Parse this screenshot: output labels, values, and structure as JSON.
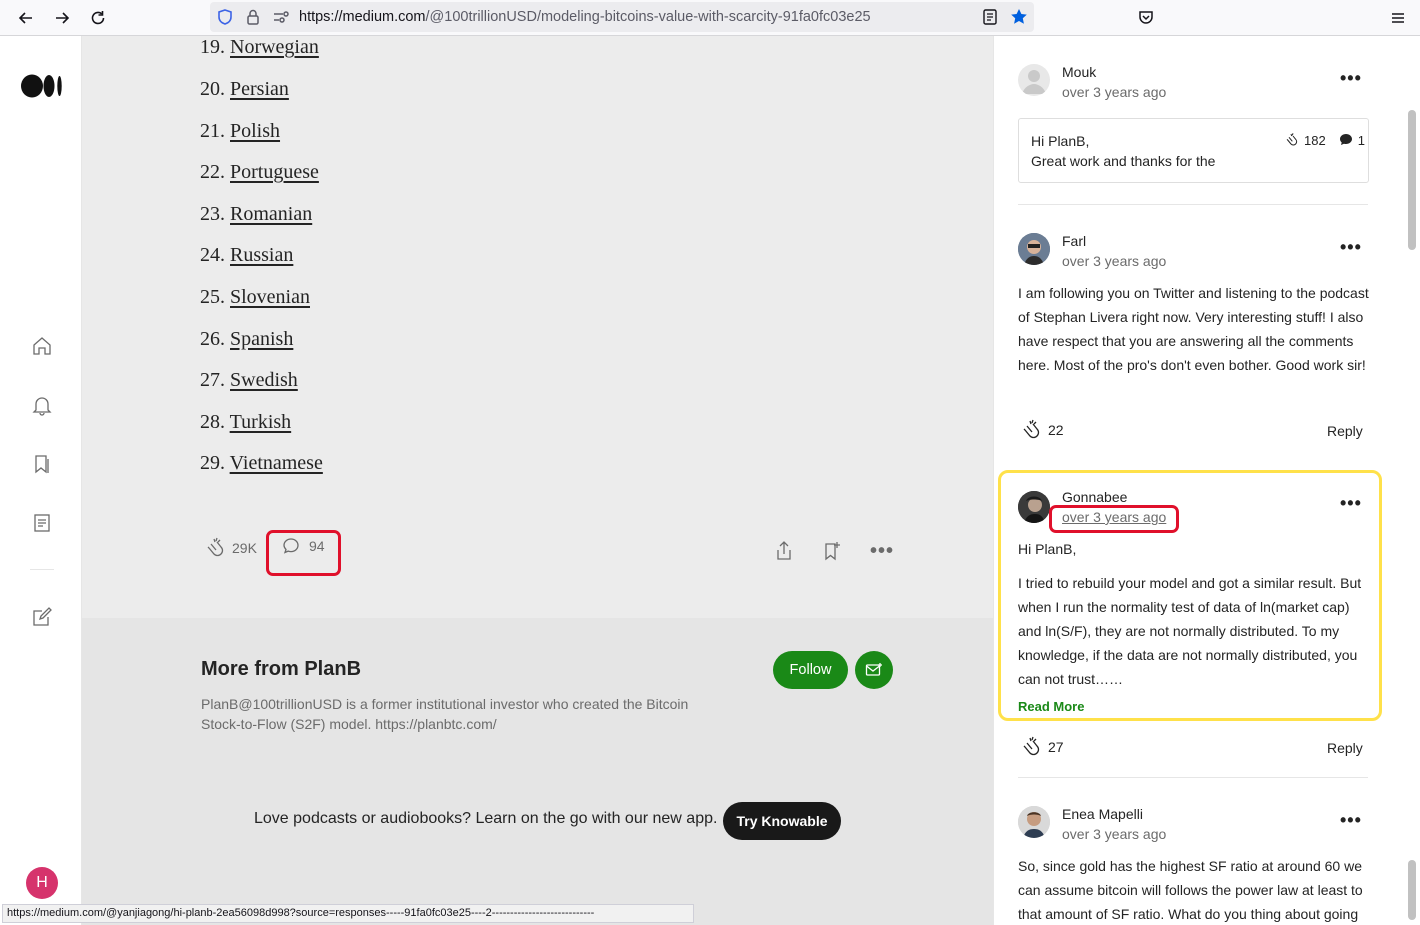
{
  "browser": {
    "url_host": "https://medium.com",
    "url_path": "/@100trillionUSD/modeling-bitcoins-value-with-scarcity-91fa0fc03e25",
    "status_url": "https://medium.com/@yanjiagong/hi-planb-2ea56098d998?source=responses-----91fa0fc03e25----2----------------------------"
  },
  "nav": {
    "avatar_letter": "H"
  },
  "article": {
    "languages": [
      {
        "num": "19.",
        "name": "Norwegian"
      },
      {
        "num": "20.",
        "name": "Persian"
      },
      {
        "num": "21.",
        "name": "Polish"
      },
      {
        "num": "22.",
        "name": "Portuguese"
      },
      {
        "num": "23.",
        "name": "Romanian"
      },
      {
        "num": "24.",
        "name": "Russian"
      },
      {
        "num": "25.",
        "name": "Slovenian"
      },
      {
        "num": "26.",
        "name": "Spanish"
      },
      {
        "num": "27.",
        "name": "Swedish"
      },
      {
        "num": "28.",
        "name": "Turkish"
      },
      {
        "num": "29.",
        "name": "Vietnamese"
      }
    ],
    "claps": "29K",
    "responses": "94"
  },
  "more_from": {
    "title": "More from PlanB",
    "description": "PlanB@100trillionUSD is a former institutional investor who created the Bitcoin Stock-to-Flow (S2F) model. https://planbtc.com/",
    "follow_label": "Follow"
  },
  "promo": {
    "text": "Love podcasts or audiobooks? Learn on the go with our new app.",
    "button": "Try Knowable"
  },
  "responses": [
    {
      "name": "Mouk",
      "time": "over 3 years ago",
      "quote_line1": "Hi PlanB,",
      "quote_line2": "Great work and thanks for the",
      "quote_claps": "182",
      "quote_replies": "1"
    },
    {
      "name": "Farl",
      "time": "over 3 years ago",
      "body": "I am following you on Twitter and listening to the podcast of Stephan Livera right now. Very interesting stuff! I also have respect that you are answering all the comments here. Most of the pro's don't even bother. Good work sir!",
      "claps": "22",
      "reply": "Reply"
    },
    {
      "name": "Gonnabee",
      "time": "over 3 years ago",
      "greeting": "Hi PlanB,",
      "body": "I tried to rebuild your model and got a similar result. But when I run the normality test of data of ln(market cap) and ln(S/F), they are not normally distributed. To my knowledge, if the data are not normally distributed, you can not trust……",
      "read_more": "Read More",
      "claps": "27",
      "reply": "Reply"
    },
    {
      "name": "Enea Mapelli",
      "time": "over 3 years ago",
      "body": "So, since gold has the highest SF ratio at around 60 we can assume bitcoin will follows the power law at least to that amount of SF ratio. What do you thing about going"
    }
  ]
}
